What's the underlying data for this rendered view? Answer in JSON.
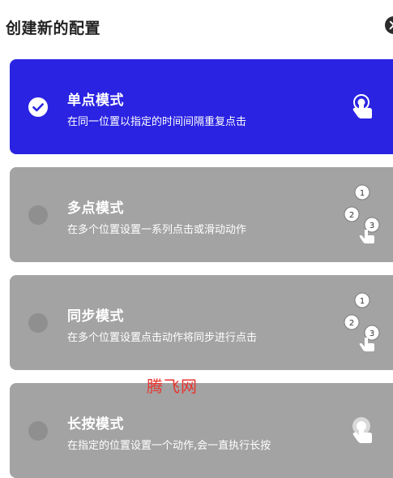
{
  "dialog": {
    "title": "创建新的配置",
    "close_icon": "close-icon"
  },
  "modes": [
    {
      "title": "单点模式",
      "description": "在同一位置以指定的时间间隔重复点击",
      "selected": true,
      "icon": "single-tap-icon"
    },
    {
      "title": "多点模式",
      "description": "在多个位置设置一系列点击或滑动动作",
      "selected": false,
      "icon": "multi-tap-icon",
      "badges": [
        "1",
        "2",
        "3"
      ]
    },
    {
      "title": "同步模式",
      "description": "在多个位置设置点击动作将同步进行点击",
      "selected": false,
      "icon": "sync-tap-icon",
      "badges": [
        "1",
        "2",
        "3"
      ]
    },
    {
      "title": "长按模式",
      "description": "在指定的位置设置一个动作,会一直执行长按",
      "selected": false,
      "icon": "long-press-icon"
    }
  ],
  "watermark": "腾飞网",
  "colors": {
    "active_card": "#2a23e2",
    "inactive_card": "#a3a3a3",
    "watermark": "#e8342e"
  }
}
